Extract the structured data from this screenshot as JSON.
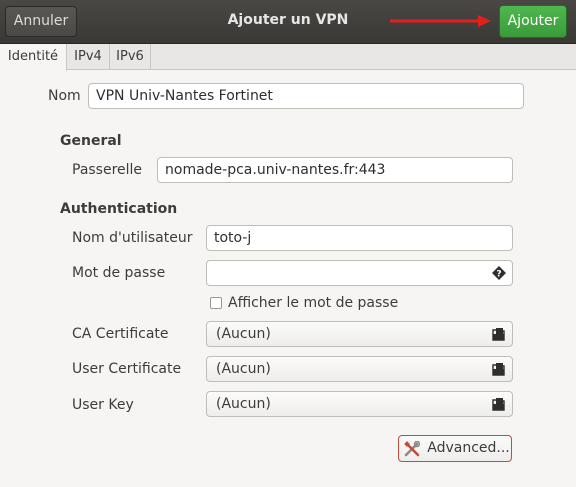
{
  "header": {
    "title": "Ajouter un VPN",
    "cancel_label": "Annuler",
    "add_label": "Ajouter",
    "annotation_color": "#e3201b"
  },
  "tabs": [
    {
      "label": "Identité",
      "active": true
    },
    {
      "label": "IPv4",
      "active": false
    },
    {
      "label": "IPv6",
      "active": false
    }
  ],
  "identity": {
    "name_label": "Nom",
    "name_value": "VPN Univ-Nantes Fortinet"
  },
  "general": {
    "heading": "General",
    "gateway_label": "Passerelle",
    "gateway_value": "nomade-pca.univ-nantes.fr:443"
  },
  "authentication": {
    "heading": "Authentication",
    "username_label": "Nom d'utilisateur",
    "username_value": "toto-j",
    "password_label": "Mot de passe",
    "password_value": "",
    "password_icon": "password-storage-icon",
    "show_password_label": "Afficher le mot de passe",
    "show_password_checked": false,
    "ca_cert_label": "CA Certificate",
    "ca_cert_value": "(Aucun)",
    "user_cert_label": "User Certificate",
    "user_cert_value": "(Aucun)",
    "user_key_label": "User Key",
    "user_key_value": "(Aucun)",
    "file_icon": "document-open-icon"
  },
  "advanced": {
    "label": "Advanced...",
    "icon": "tools-icon"
  },
  "colors": {
    "accent_green": "#3a9a3a",
    "header_bg": "#3a3835",
    "advanced_border": "#c64a37"
  }
}
